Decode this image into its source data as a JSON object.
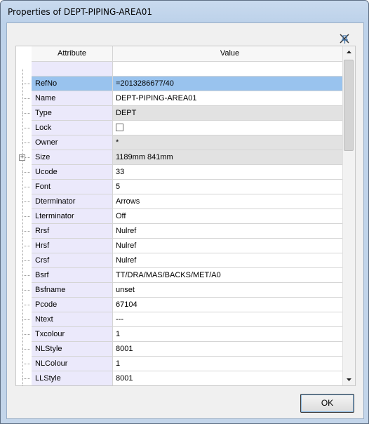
{
  "window": {
    "title": "Properties of DEPT-PIPING-AREA01"
  },
  "grid": {
    "columns": {
      "attribute": "Attribute",
      "value": "Value"
    },
    "rows": [
      {
        "attribute": "RefNo",
        "value": "=2013286677/40",
        "state": "selected"
      },
      {
        "attribute": "Name",
        "value": "DEPT-PIPING-AREA01",
        "state": "editable"
      },
      {
        "attribute": "Type",
        "value": "DEPT",
        "state": "readonly"
      },
      {
        "attribute": "Lock",
        "value": "",
        "state": "checkbox",
        "checked": false
      },
      {
        "attribute": "Owner",
        "value": "*",
        "state": "readonly"
      },
      {
        "attribute": "Size",
        "value": "1189mm 841mm",
        "state": "readonly",
        "expandable": true
      },
      {
        "attribute": "Ucode",
        "value": "33",
        "state": "editable"
      },
      {
        "attribute": "Font",
        "value": "5",
        "state": "editable"
      },
      {
        "attribute": "Dterminator",
        "value": "Arrows",
        "state": "editable"
      },
      {
        "attribute": "Lterminator",
        "value": "Off",
        "state": "editable"
      },
      {
        "attribute": "Rrsf",
        "value": "Nulref",
        "state": "editable"
      },
      {
        "attribute": "Hrsf",
        "value": "Nulref",
        "state": "editable"
      },
      {
        "attribute": "Crsf",
        "value": "Nulref",
        "state": "editable"
      },
      {
        "attribute": "Bsrf",
        "value": "TT/DRA/MAS/BACKS/MET/A0",
        "state": "editable"
      },
      {
        "attribute": "Bsfname",
        "value": "unset",
        "state": "editable"
      },
      {
        "attribute": "Pcode",
        "value": "67104",
        "state": "editable"
      },
      {
        "attribute": "Ntext",
        "value": "---",
        "state": "editable"
      },
      {
        "attribute": "Txcolour",
        "value": "1",
        "state": "editable"
      },
      {
        "attribute": "NLStyle",
        "value": "8001",
        "state": "editable"
      },
      {
        "attribute": "NLColour",
        "value": "1",
        "state": "editable"
      },
      {
        "attribute": "LLStyle",
        "value": "8001",
        "state": "editable"
      }
    ]
  },
  "footer": {
    "ok_label": "OK"
  },
  "icons": {
    "pin": "pin-icon",
    "expand": "plus-icon"
  },
  "colors": {
    "selected_row": "#99c3ee",
    "readonly_cell": "#e2e2e2",
    "attribute_column": "#ebe9fb"
  }
}
